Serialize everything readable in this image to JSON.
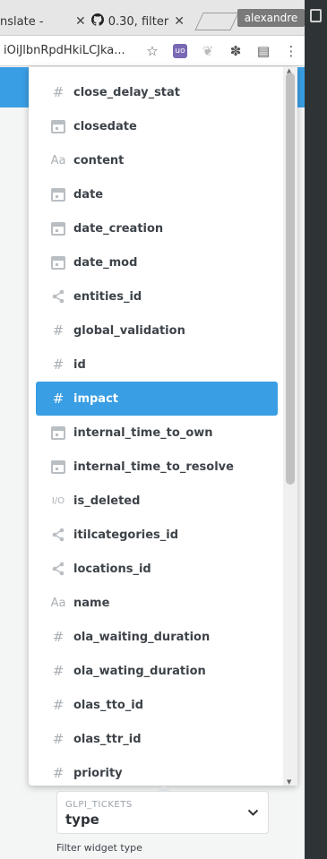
{
  "browser": {
    "tabs": [
      {
        "label": "nslate - ",
        "close": "✕"
      },
      {
        "label": "0.30, filter ",
        "close": "✕"
      }
    ],
    "user_chip": "alexandre",
    "url": "iOiJlbnRpdHkiLCJka..."
  },
  "dropdown": {
    "items": [
      {
        "label": "close_delay_stat",
        "icon": "#"
      },
      {
        "label": "closedate",
        "icon": "calendar"
      },
      {
        "label": "content",
        "icon": "Aa"
      },
      {
        "label": "date",
        "icon": "calendar"
      },
      {
        "label": "date_creation",
        "icon": "calendar"
      },
      {
        "label": "date_mod",
        "icon": "calendar"
      },
      {
        "label": "entities_id",
        "icon": "share"
      },
      {
        "label": "global_validation",
        "icon": "#"
      },
      {
        "label": "id",
        "icon": "#"
      },
      {
        "label": "impact",
        "icon": "#",
        "selected": true
      },
      {
        "label": "internal_time_to_own",
        "icon": "calendar"
      },
      {
        "label": "internal_time_to_resolve",
        "icon": "calendar"
      },
      {
        "label": "is_deleted",
        "icon": "I/O"
      },
      {
        "label": "itilcategories_id",
        "icon": "share"
      },
      {
        "label": "locations_id",
        "icon": "share"
      },
      {
        "label": "name",
        "icon": "Aa"
      },
      {
        "label": "ola_waiting_duration",
        "icon": "#"
      },
      {
        "label": "ola_wating_duration",
        "icon": "#"
      },
      {
        "label": "olas_tto_id",
        "icon": "#"
      },
      {
        "label": "olas_ttr_id",
        "icon": "#"
      },
      {
        "label": "priority",
        "icon": "#"
      }
    ]
  },
  "filter_widget": {
    "table_label": "GLPI_TICKETS",
    "value": "type",
    "help": "Filter widget type"
  },
  "colors": {
    "accent": "#3a9ee4",
    "icon_gray": "#aab0b5",
    "text": "#3d4349"
  }
}
